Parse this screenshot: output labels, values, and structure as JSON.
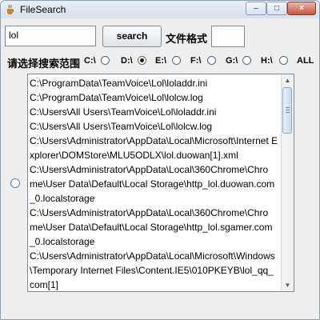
{
  "window": {
    "title": "FileSearch",
    "min_label": "–",
    "max_label": "□",
    "close_label": "×"
  },
  "search": {
    "query": "lol",
    "button_label": "search",
    "format_label": "文件格式",
    "format_value": ""
  },
  "range": {
    "label": "请选择搜索范围",
    "drives": [
      {
        "label": "C:\\",
        "checked": false
      },
      {
        "label": "D:\\",
        "checked": true
      },
      {
        "label": "E:\\",
        "checked": false
      },
      {
        "label": "F:\\",
        "checked": false
      },
      {
        "label": "G:\\",
        "checked": false
      },
      {
        "label": "H:\\",
        "checked": false
      },
      {
        "label": "ALL",
        "checked": false
      }
    ]
  },
  "results": {
    "lines": [
      "C:\\ProgramData\\TeamVoice\\Lol\\loladdr.ini",
      "C:\\ProgramData\\TeamVoice\\Lol\\lolcw.log",
      "C:\\Users\\All Users\\TeamVoice\\Lol\\loladdr.ini",
      "C:\\Users\\All Users\\TeamVoice\\Lol\\lolcw.log",
      "C:\\Users\\Administrator\\AppData\\Local\\Microsoft\\Internet E",
      "xplorer\\DOMStore\\MLU5ODLX\\lol.duowan[1].xml",
      "C:\\Users\\Administrator\\AppData\\Local\\360Chrome\\Chro",
      "me\\User Data\\Default\\Local Storage\\http_lol.duowan.com",
      "_0.localstorage",
      "C:\\Users\\Administrator\\AppData\\Local\\360Chrome\\Chro",
      "me\\User Data\\Default\\Local Storage\\http_lol.sgamer.com",
      "_0.localstorage",
      "C:\\Users\\Administrator\\AppData\\Local\\Microsoft\\Windows",
      "\\Temporary Internet Files\\Content.IE5\\010PKEYB\\lol_qq_",
      "com[1]"
    ]
  },
  "icons": {
    "app": "java-cup-icon",
    "scroll_up": "chevron-up-icon",
    "scroll_down": "chevron-down-icon"
  }
}
